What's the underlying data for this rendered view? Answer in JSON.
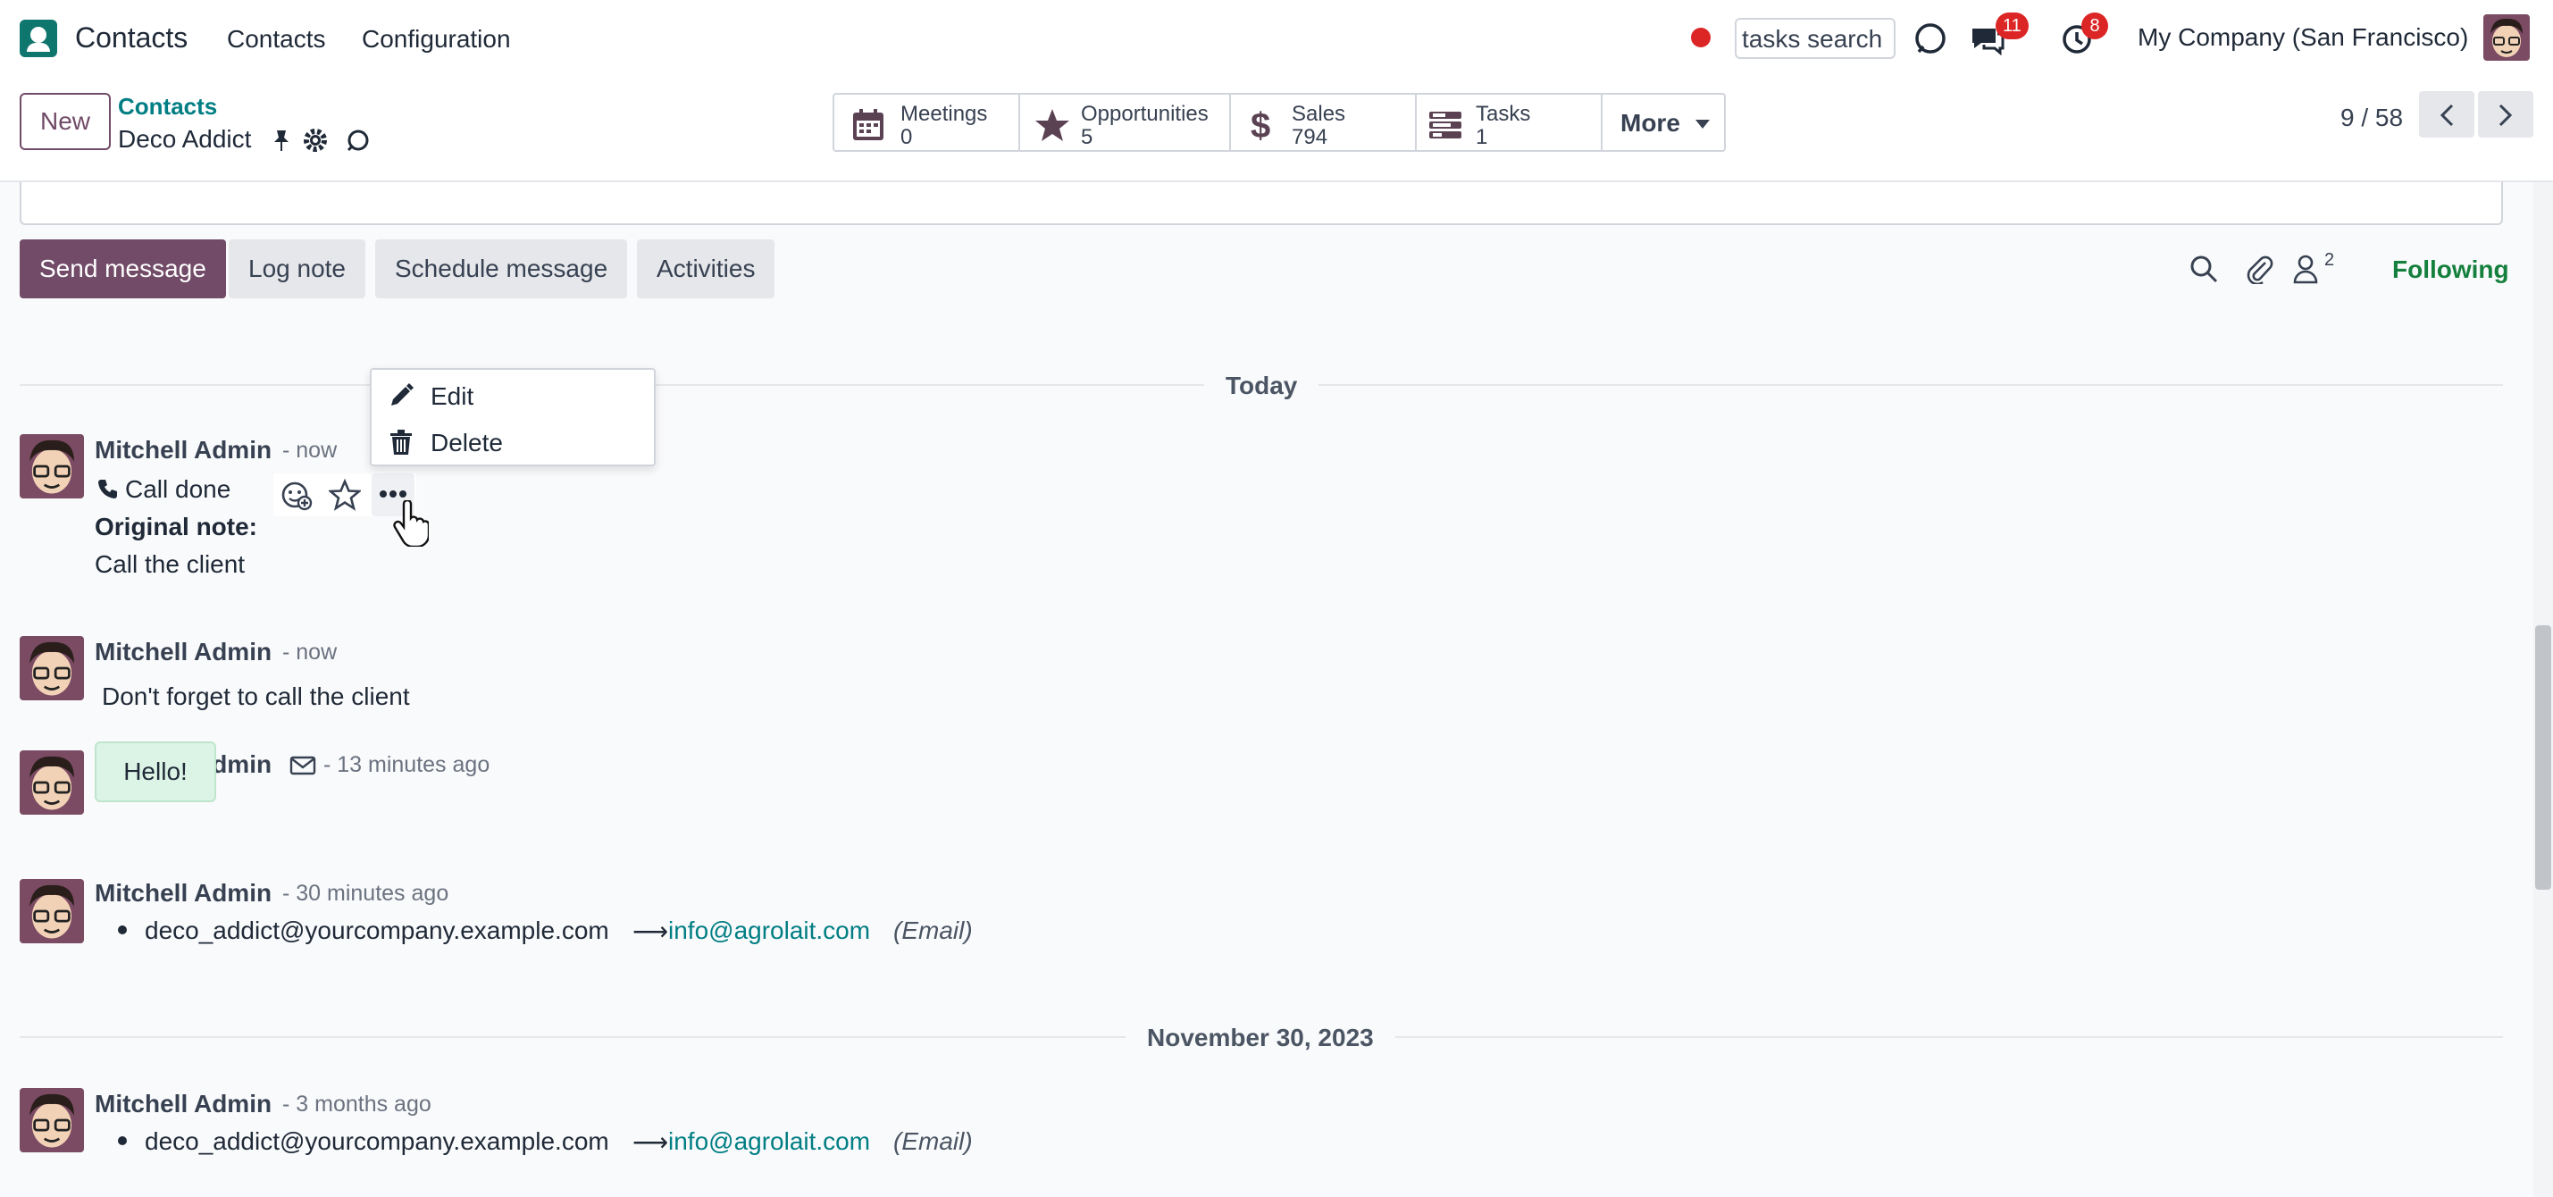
{
  "top_nav": {
    "app_name": "Contacts",
    "menus": [
      "Contacts",
      "Configuration"
    ],
    "search_placeholder": "tasks search",
    "messages_badge": "11",
    "activities_badge": "8",
    "company": "My Company (San Francisco)"
  },
  "control_panel": {
    "new_label": "New",
    "breadcrumb_parent": "Contacts",
    "breadcrumb_current": "Deco Addict",
    "smart_buttons": [
      {
        "label": "Meetings",
        "value": "0",
        "icon": "calendar-icon"
      },
      {
        "label": "Opportunities",
        "value": "5",
        "icon": "star-icon"
      },
      {
        "label": "Sales",
        "value": "794",
        "icon": "dollar-icon"
      },
      {
        "label": "Tasks",
        "value": "1",
        "icon": "tasks-icon"
      }
    ],
    "more_label": "More",
    "pager": "9 / 58"
  },
  "chatter": {
    "buttons": [
      "Send message",
      "Log note",
      "Schedule message",
      "Activities"
    ],
    "follower_count": "2",
    "following_label": "Following",
    "dropdown": [
      "Edit",
      "Delete"
    ],
    "groups": [
      {
        "date": "Today",
        "messages": [
          {
            "author": "Mitchell Admin",
            "time": "- now",
            "activity": "Call done",
            "note_title": "Original note:",
            "body": "Call the client"
          },
          {
            "author": "Mitchell Admin",
            "time": "- now",
            "body": "Don't forget to call the client"
          },
          {
            "author": "Mitchell Admin",
            "time": "- 13 minutes ago",
            "body": "Hello!"
          },
          {
            "author": "Mitchell Admin",
            "time": "- 30 minutes ago",
            "old_value": "deco_addict@yourcompany.example.com",
            "arrow": "⟶",
            "new_value": "info@agrolait.com",
            "field": "(Email)"
          }
        ]
      },
      {
        "date": "November 30, 2023",
        "messages": [
          {
            "author": "Mitchell Admin",
            "time": "- 3 months ago",
            "old_value": "deco_addict@yourcompany.example.com",
            "arrow": "⟶",
            "new_value": "info@agrolait.com",
            "field": "(Email)"
          }
        ]
      }
    ]
  },
  "colors": {
    "brand": "#714b67",
    "link": "#017e84",
    "following": "#15803d",
    "badge": "#dc2626"
  }
}
